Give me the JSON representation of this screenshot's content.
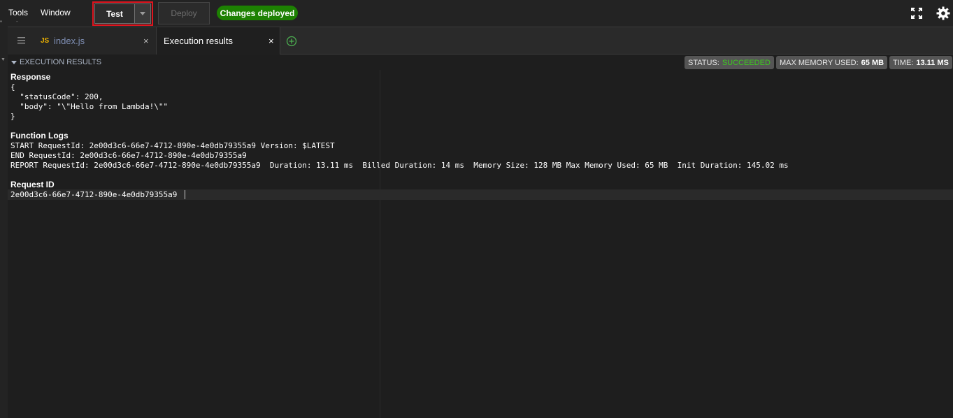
{
  "menu": {
    "tools": "Tools",
    "window": "Window"
  },
  "toolbar": {
    "test_label": "Test",
    "deploy_label": "Deploy",
    "status_badge": "Changes deployed"
  },
  "tabs": [
    {
      "icon_text": "JS",
      "label": "index.js",
      "close": "×"
    },
    {
      "label": "Execution results",
      "close": "×"
    }
  ],
  "execution": {
    "header": "EXECUTION RESULTS",
    "status_label": "STATUS:",
    "status_value": "SUCCEEDED",
    "memory_label": "MAX MEMORY USED:",
    "memory_value": "65 MB",
    "time_label": "TIME:",
    "time_value": "13.11 MS"
  },
  "response": {
    "title": "Response",
    "lines": [
      "{",
      "  \"statusCode\": 200,",
      "  \"body\": \"\\\"Hello from Lambda!\\\"\"",
      "}"
    ]
  },
  "logs": {
    "title": "Function Logs",
    "lines": [
      "START RequestId: 2e00d3c6-66e7-4712-890e-4e0db79355a9 Version: $LATEST",
      "END RequestId: 2e00d3c6-66e7-4712-890e-4e0db79355a9",
      "REPORT RequestId: 2e00d3c6-66e7-4712-890e-4e0db79355a9  Duration: 13.11 ms  Billed Duration: 14 ms  Memory Size: 128 MB Max Memory Used: 65 MB  Init Duration: 145.02 ms"
    ]
  },
  "request_id": {
    "title": "Request ID",
    "value": "2e00d3c6-66e7-4712-890e-4e0db79355a9"
  },
  "colors": {
    "success": "#1d8102",
    "succeeded_text": "#3dca1f",
    "highlight": "#e0141e",
    "js_icon": "#f0b400"
  },
  "icons": [
    "menu-icon",
    "js-file-icon",
    "close-icon",
    "add-tab-icon",
    "fullscreen-icon",
    "gear-icon",
    "caret-down-icon"
  ]
}
